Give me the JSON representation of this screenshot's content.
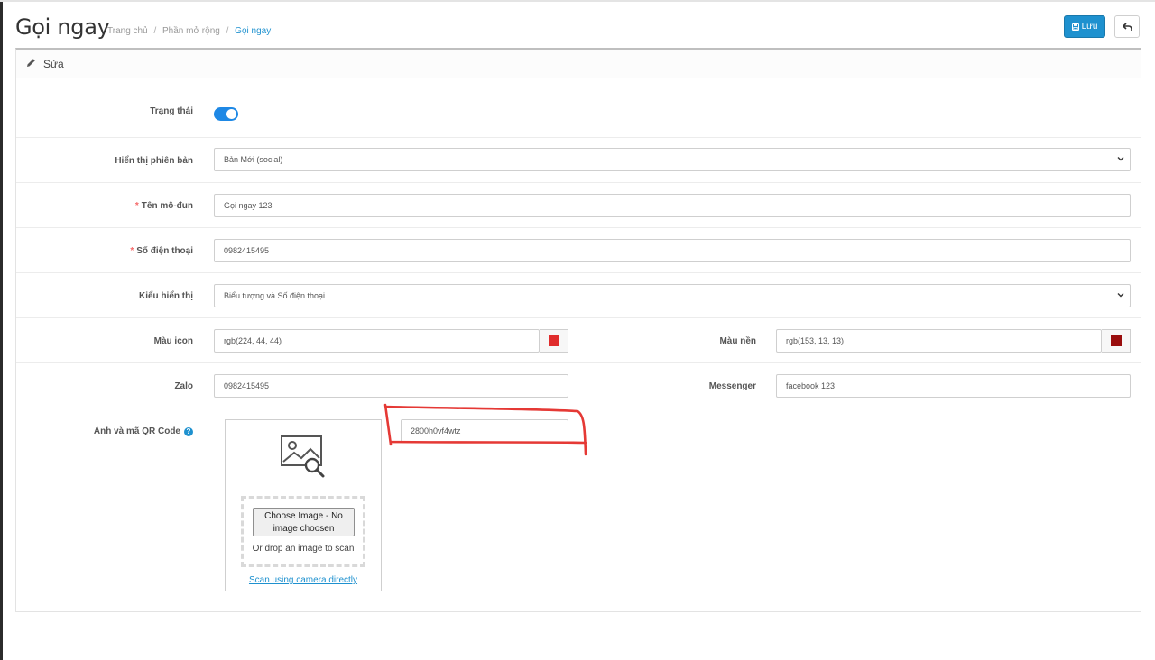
{
  "header": {
    "title": "Gọi ngay",
    "breadcrumb": [
      "Trang chủ",
      "Phần mở rộng",
      "Gọi ngay"
    ],
    "breadcrumb_sep": "/",
    "save_label": "Lưu",
    "save_icon": "floppy-disk-icon",
    "back_icon": "reply-arrow-icon"
  },
  "panel": {
    "title": "Sửa",
    "title_icon": "pencil-icon"
  },
  "form": {
    "status": {
      "label": "Trạng thái",
      "enabled": true
    },
    "version": {
      "label": "Hiển thị phiên bản",
      "value": "Bản Mới (social)"
    },
    "module_name": {
      "label": "Tên mô-đun",
      "required": true,
      "value": "Gọi ngay 123"
    },
    "phone": {
      "label": "Số điện thoại",
      "required": true,
      "value": "0982415495"
    },
    "display_type": {
      "label": "Kiểu hiển thị",
      "value": "Biểu tượng và Số điện thoại"
    },
    "icon_color": {
      "label": "Màu icon",
      "value": "rgb(224, 44, 44)",
      "swatch": "#e02c2c"
    },
    "bg_color": {
      "label": "Màu nền",
      "value": "rgb(153, 13, 13)",
      "swatch": "#990d0d"
    },
    "zalo": {
      "label": "Zalo",
      "value": "0982415495"
    },
    "messenger": {
      "label": "Messenger",
      "value": "facebook 123"
    },
    "qr": {
      "label": "Ảnh và mã QR Code",
      "help_icon": "question-circle-icon",
      "choose_button": "Choose Image - No image choosen",
      "drop_text": "Or drop an image to scan",
      "scan_link": "Scan using camera directly",
      "code_value": "2800h0vf4wtz"
    }
  },
  "colors": {
    "accent": "#1e91cf",
    "annotation": "#e53935",
    "required": "#f56b6b"
  }
}
